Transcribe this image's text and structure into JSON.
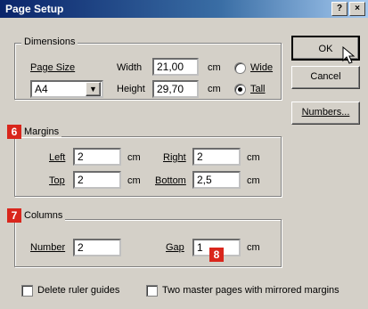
{
  "window": {
    "title": "Page Setup",
    "help_btn": "?",
    "close_btn": "×"
  },
  "dimensions": {
    "legend": "Dimensions",
    "page_size_label": "Page Size",
    "page_size_value": "A4",
    "width_label": "Width",
    "width_value": "21,00",
    "height_label": "Height",
    "height_value": "29,70",
    "unit": "cm",
    "orientation_wide": "Wide",
    "orientation_tall": "Tall",
    "orientation_selected": "Tall"
  },
  "margins": {
    "badge": "6",
    "legend": "Margins",
    "left_label": "Left",
    "left_value": "2",
    "right_label": "Right",
    "right_value": "2",
    "top_label": "Top",
    "top_value": "2",
    "bottom_label": "Bottom",
    "bottom_value": "2,5",
    "unit": "cm"
  },
  "columns": {
    "badge": "7",
    "legend": "Columns",
    "number_label": "Number",
    "number_value": "2",
    "gap_label": "Gap",
    "gap_value": "1",
    "gap_badge": "8",
    "unit": "cm"
  },
  "buttons": {
    "ok": "OK",
    "cancel": "Cancel",
    "numbers": "Numbers..."
  },
  "options": {
    "delete_guides": "Delete ruler guides",
    "two_master": "Two master pages with mirrored margins"
  },
  "colors": {
    "badge": "#d9261c",
    "titlebar": "#0a246a"
  }
}
